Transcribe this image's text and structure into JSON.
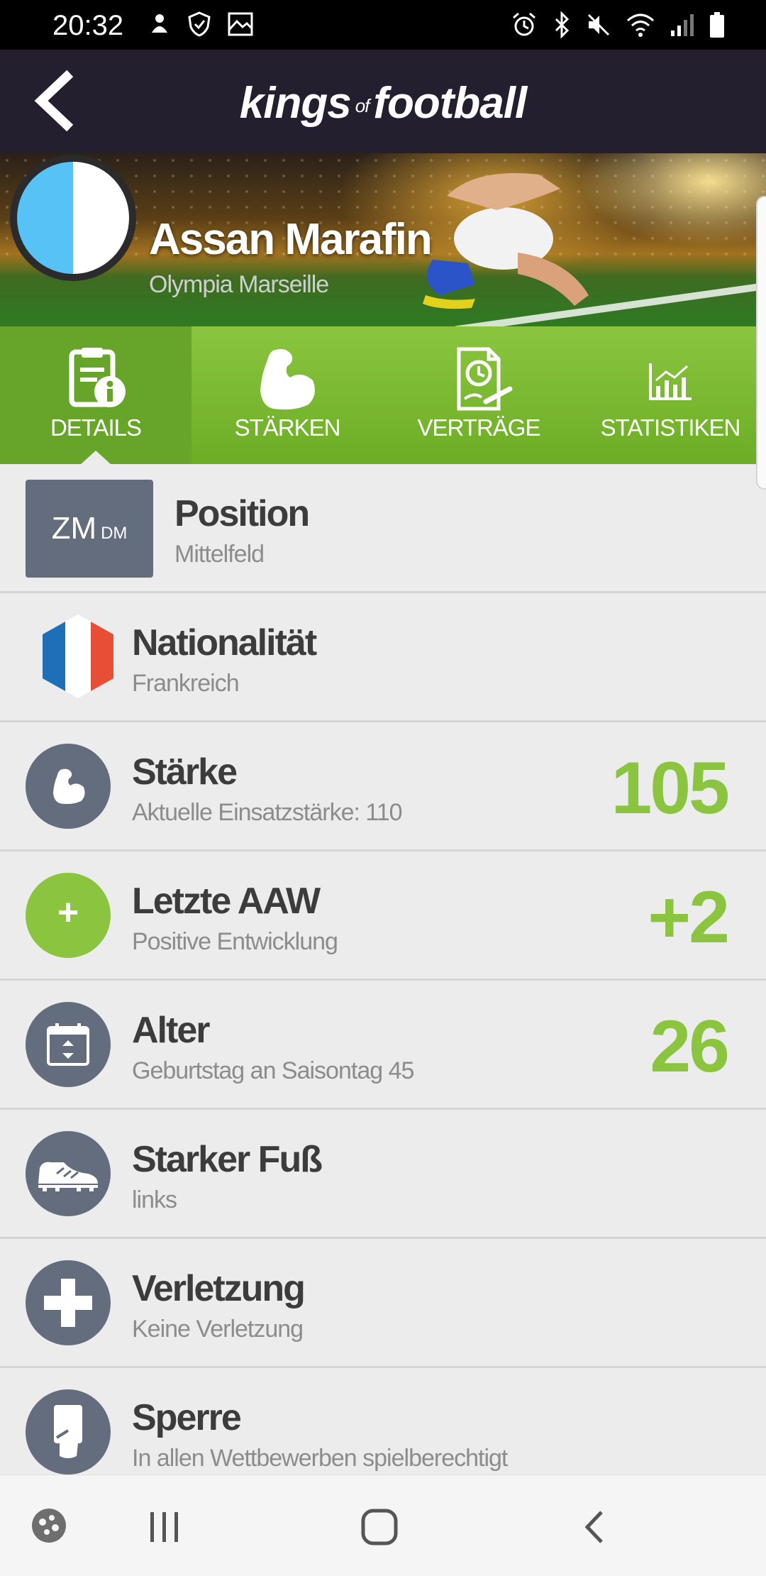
{
  "status_bar": {
    "time": "20:32",
    "left_icons": [
      "notification-icon",
      "shield-icon",
      "gallery-icon"
    ],
    "right_icons": [
      "alarm-icon",
      "bluetooth-icon",
      "mute-icon",
      "wifi-icon",
      "signal-icon",
      "battery-icon"
    ]
  },
  "app_bar": {
    "back_icon": "back-arrow-icon",
    "logo_left": "kings",
    "logo_mid": "of",
    "logo_right": "football"
  },
  "player": {
    "name": "Assan Marafin",
    "club": "Olympia Marseille",
    "club_colors": [
      "#56c2f5",
      "#ffffff"
    ]
  },
  "tabs": [
    {
      "label": "DETAILS",
      "icon": "details-icon",
      "active": true
    },
    {
      "label": "STÄRKEN",
      "icon": "muscle-icon",
      "active": false
    },
    {
      "label": "VERTRÄGE",
      "icon": "contract-icon",
      "active": false
    },
    {
      "label": "STATISTIKEN",
      "icon": "statistics-icon",
      "active": false
    }
  ],
  "details": {
    "position": {
      "badge_main": "ZM",
      "badge_secondary": "DM",
      "title": "Position",
      "subtitle": "Mittelfeld"
    },
    "nationality": {
      "title": "Nationalität",
      "subtitle": "Frankreich",
      "icon": "france-flag-icon"
    },
    "strength": {
      "title": "Stärke",
      "subtitle": "Aktuelle Einsatzstärke: 110",
      "value": "105",
      "icon": "muscle-icon"
    },
    "last_aaw": {
      "title": "Letzte AAW",
      "subtitle": "Positive Entwicklung",
      "value": "+2",
      "icon_text": "+"
    },
    "age": {
      "title": "Alter",
      "subtitle": "Geburtstag an Saisontag 45",
      "value": "26",
      "icon": "calendar-icon"
    },
    "foot": {
      "title": "Starker Fuß",
      "subtitle": "links",
      "icon": "football-boot-icon"
    },
    "injury": {
      "title": "Verletzung",
      "subtitle": "Keine Verletzung",
      "icon": "medical-cross-icon"
    },
    "ban": {
      "title": "Sperre",
      "subtitle": "In allen Wettbewerben spielberechtigt",
      "icon": "card-icon"
    }
  },
  "colors": {
    "accent_green": "#8bc53f",
    "dark_header": "#231f2e",
    "icon_grey": "#646d7e"
  },
  "nav_bar": [
    "game-launcher-icon",
    "recent-apps-icon",
    "home-icon",
    "back-icon"
  ]
}
